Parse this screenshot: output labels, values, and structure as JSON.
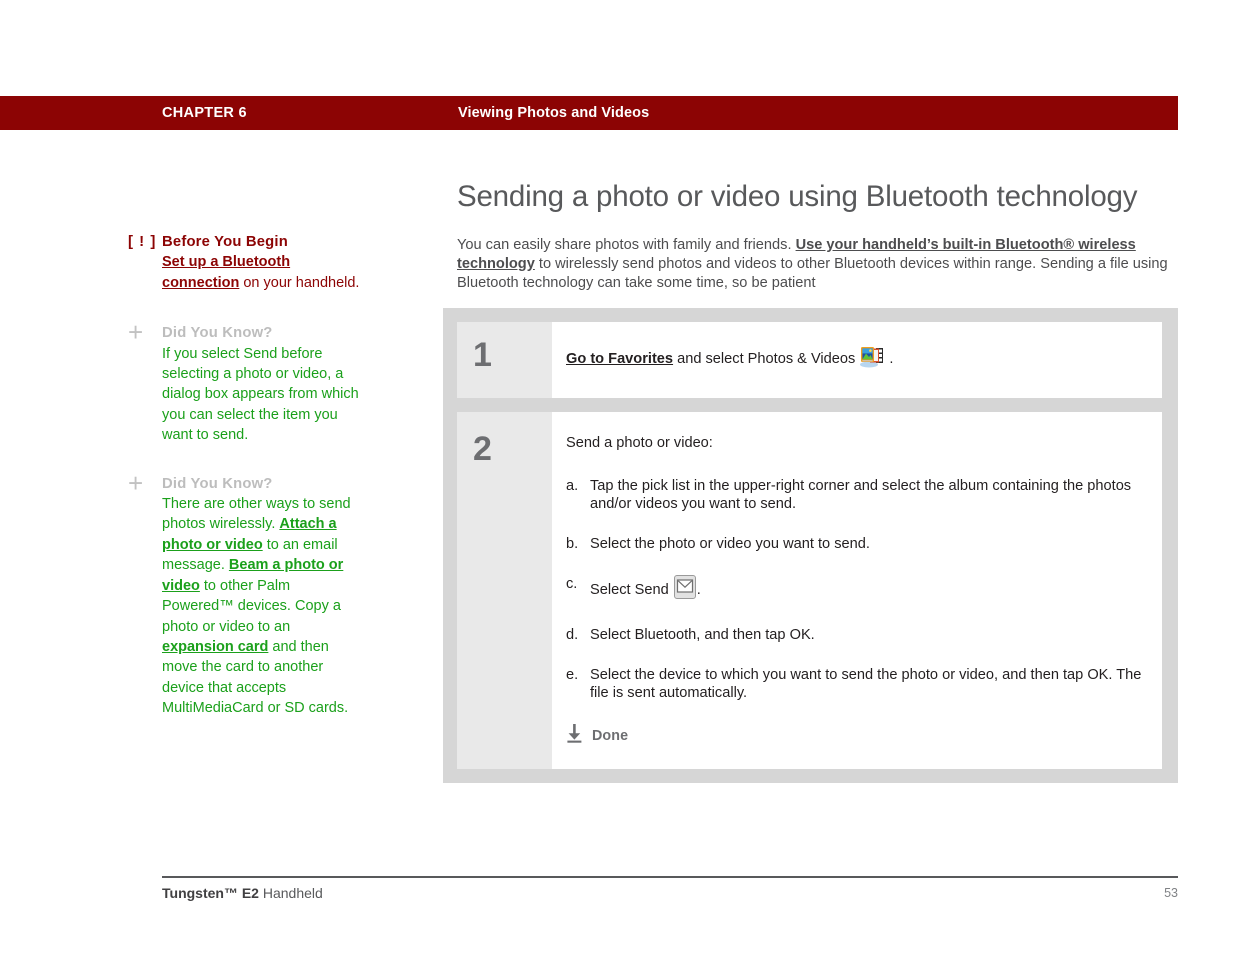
{
  "header": {
    "chapter": "CHAPTER 6",
    "title": "Viewing Photos and Videos",
    "bar_color": "#8c0404"
  },
  "sidebar": {
    "blocks": [
      {
        "marker": "[ ! ]",
        "marker_kind": "alert-icon",
        "heading": "Before You Begin",
        "heading_color": "#8c0404",
        "text_color": "#8c0404",
        "link_text": "Set up a Bluetooth connection",
        "body_after_link": " on your handheld."
      },
      {
        "marker": "+",
        "marker_kind": "plus-icon",
        "heading": "Did You Know?",
        "heading_color": "#bdbdbd",
        "text_color": "#1ba01b",
        "body": "If you select Send before selecting a photo or video, a dialog box appears from which you can select the item you want to send."
      },
      {
        "marker": "+",
        "marker_kind": "plus-icon",
        "heading": "Did You Know?",
        "heading_color": "#bdbdbd",
        "text_color": "#1ba01b",
        "part1": "There are other ways to send photos wirelessly. ",
        "link1": "Attach a photo or video",
        "part2": " to an email message. ",
        "link2": "Beam a photo or video",
        "part3": " to other Palm Powered™ devices. Copy a photo or video to an ",
        "link3": "expansion card",
        "part4": " and then move the card to another device that accepts MultiMediaCard or SD cards."
      }
    ]
  },
  "main": {
    "heading": "Sending a photo or video using Bluetooth technology",
    "intro": {
      "part1": "You can easily share photos with family and friends. ",
      "link": "Use your handheld’s built-in Bluetooth® wireless technology",
      "part2": " to wirelessly send photos and videos to other Bluetooth devices within range. Sending a file using Bluetooth technology can take some time, so be patient"
    },
    "steps": [
      {
        "number": "1",
        "link": "Go to Favorites",
        "text_after_link": " and select Photos & Videos ",
        "icon": "photos-videos-icon",
        "trailing": "."
      },
      {
        "number": "2",
        "intro": "Send a photo or video:",
        "substeps": [
          {
            "letter": "a.",
            "text": "Tap the pick list in the upper-right corner and select the album containing the photos and/or videos you want to send."
          },
          {
            "letter": "b.",
            "text": "Select the photo or video you want to send."
          },
          {
            "letter": "c.",
            "text_before_icon": "Select Send ",
            "icon": "send-envelope-icon",
            "trailing": "."
          },
          {
            "letter": "d.",
            "text": "Select Bluetooth, and then tap OK."
          },
          {
            "letter": "e.",
            "text": "Select the device to which you want to send the photo or video, and then tap OK. The file is sent automatically."
          }
        ],
        "done_label": "Done",
        "done_icon": "down-arrow-icon"
      }
    ]
  },
  "footer": {
    "product_bold": "Tungsten™ E2",
    "product_rest": " Handheld",
    "page_number": "53"
  }
}
